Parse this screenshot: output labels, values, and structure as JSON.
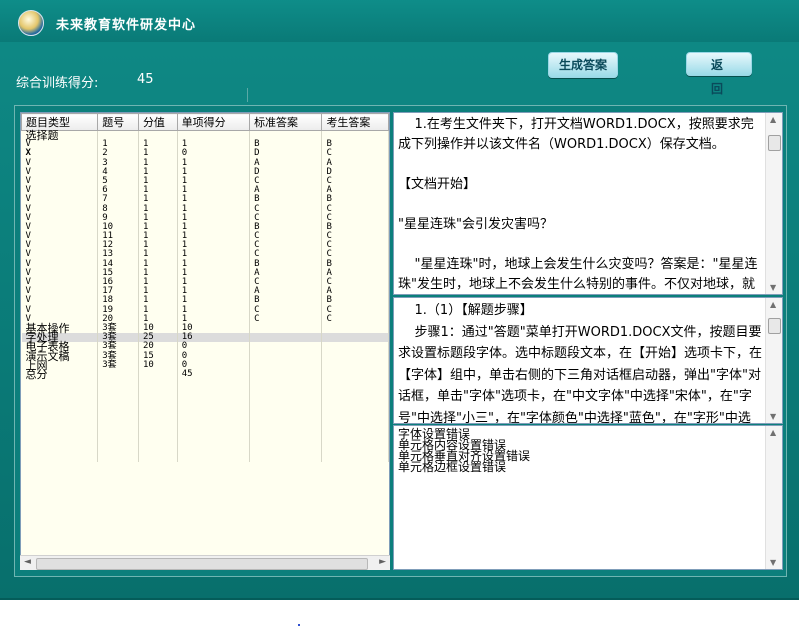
{
  "app": {
    "title": "未来教育软件研发中心",
    "icon": "logo-icon"
  },
  "score": {
    "label": "综合训练得分:",
    "value": "45"
  },
  "buttons": {
    "generate": "生成答案",
    "back": "返 回"
  },
  "table": {
    "headers": [
      "题目类型",
      "题号",
      "分值",
      "单项得分",
      "标准答案",
      "考生答案"
    ],
    "section_label": "选择题",
    "choice_rows": [
      [
        "V",
        "1",
        "1",
        "1",
        "B",
        "B"
      ],
      [
        "X",
        "2",
        "1",
        "0",
        "D",
        "C"
      ],
      [
        "V",
        "3",
        "1",
        "1",
        "A",
        "A"
      ],
      [
        "V",
        "4",
        "1",
        "1",
        "D",
        "D"
      ],
      [
        "V",
        "5",
        "1",
        "1",
        "C",
        "C"
      ],
      [
        "V",
        "6",
        "1",
        "1",
        "A",
        "A"
      ],
      [
        "V",
        "7",
        "1",
        "1",
        "B",
        "B"
      ],
      [
        "V",
        "8",
        "1",
        "1",
        "C",
        "C"
      ],
      [
        "V",
        "9",
        "1",
        "1",
        "C",
        "C"
      ],
      [
        "V",
        "10",
        "1",
        "1",
        "B",
        "B"
      ],
      [
        "V",
        "11",
        "1",
        "1",
        "C",
        "C"
      ],
      [
        "V",
        "12",
        "1",
        "1",
        "C",
        "C"
      ],
      [
        "V",
        "13",
        "1",
        "1",
        "C",
        "C"
      ],
      [
        "V",
        "14",
        "1",
        "1",
        "B",
        "B"
      ],
      [
        "V",
        "15",
        "1",
        "1",
        "A",
        "A"
      ],
      [
        "V",
        "16",
        "1",
        "1",
        "C",
        "C"
      ],
      [
        "V",
        "17",
        "1",
        "1",
        "A",
        "A"
      ],
      [
        "V",
        "18",
        "1",
        "1",
        "B",
        "B"
      ],
      [
        "V",
        "19",
        "1",
        "1",
        "C",
        "C"
      ],
      [
        "V",
        "20",
        "1",
        "1",
        "C",
        "C"
      ]
    ],
    "op_rows": [
      [
        "基本操作",
        "3套",
        "10",
        "10"
      ],
      [
        "字处理",
        "3套",
        "25",
        "16"
      ],
      [
        "电子表格",
        "3套",
        "20",
        "0"
      ],
      [
        "演示文稿",
        "3套",
        "15",
        "0"
      ],
      [
        "上网",
        "3套",
        "10",
        "0"
      ]
    ],
    "total": [
      "总分",
      "",
      "",
      "45"
    ],
    "selected_row": "字处理"
  },
  "panels": {
    "question": "    1.在考生文件夹下，打开文档WORD1.DOCX，按照要求完成下列操作并以该文件名（WORD1.DOCX）保存文档。\n\n【文档开始】\n\n\"星星连珠\"会引发灾害吗？\n\n    \"星星连珠\"时，地球上会发生什么灾变吗？答案是：\"星星连珠\"发生时，地球上不会发生什么特别的事件。不仅对地球，就是对其它星星、小星星和彗星也一样不会产",
    "steps": "    1.（1）【解题步骤】\n    步骤1：通过\"答题\"菜单打开WORD1.DOCX文件，按题目要求设置标题段字体。选中标题段文本，在【开始】选项卡下，在【字体】组中，单击右侧的下三角对话框启动器，弹出\"字体\"对话框，单击\"字体\"选项卡，在\"中文字体\"中选择\"宋体\"，在\"字号\"中选择\"小三\"，在\"字体颜色\"中选择\"蓝色\"，在\"字形\"中选择\"加粗\"，单击\"确定\"按钮返回到",
    "errors": "字体设置错误\n单元格内容设置错误\n单元格垂直对齐设置错误\n单元格边框设置错误"
  }
}
